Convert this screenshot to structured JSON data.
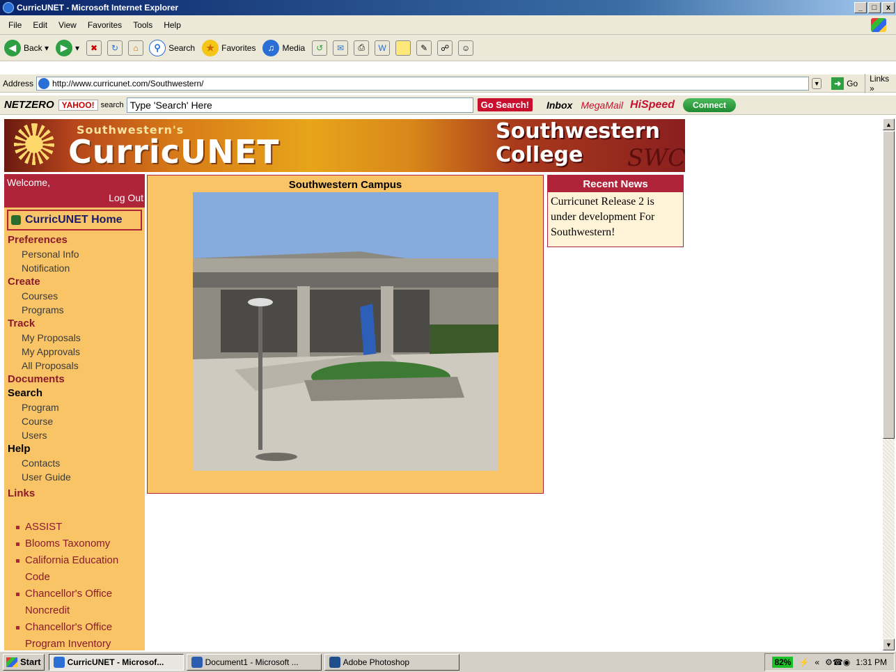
{
  "window": {
    "title": "CurricUNET - Microsoft Internet Explorer",
    "min": "_",
    "max": "□",
    "close": "x"
  },
  "menu": [
    "File",
    "Edit",
    "View",
    "Favorites",
    "Tools",
    "Help"
  ],
  "toolbar": {
    "back": "Back",
    "search": "Search",
    "favorites": "Favorites",
    "media": "Media"
  },
  "address": {
    "label": "Address",
    "url": "http://www.curricunet.com/Southwestern/",
    "go": "Go",
    "links": "Links"
  },
  "netzero": {
    "logo": "NETZERO",
    "yahoo": "YAHOO!",
    "search_word": "search",
    "search_placeholder": "Type 'Search' Here",
    "go_search": "Go Search!",
    "inbox": "Inbox",
    "megamail": "MegaMail",
    "hispeed": "HiSpeed",
    "connect": "Connect"
  },
  "banner": {
    "subtitle": "Southwestern's",
    "title": "CurricUNET",
    "college1": "Southwestern",
    "college2": "College",
    "swc": "SWC"
  },
  "sidebar": {
    "welcome": "Welcome,",
    "logout": "Log Out",
    "home": "CurricUNET Home",
    "sections": [
      {
        "title": "Preferences",
        "items": [
          "Personal Info",
          "Notification"
        ]
      },
      {
        "title": "Create",
        "items": [
          "Courses",
          "Programs"
        ]
      },
      {
        "title": "Track",
        "items": [
          "My Proposals",
          "My Approvals",
          "All Proposals"
        ]
      },
      {
        "title": "Documents",
        "items": []
      },
      {
        "title": "Search",
        "items": [
          "Program",
          "Course",
          "Users"
        ]
      },
      {
        "title": "Help",
        "items": [
          "Contacts",
          "User Guide"
        ]
      },
      {
        "title": "Links",
        "items": []
      }
    ],
    "links": [
      "ASSIST",
      "Blooms Taxonomy",
      "California Education Code",
      "Chancellor's Office Noncredit",
      "Chancellor's Office Program Inventory"
    ]
  },
  "campus": {
    "title": "Southwestern Campus"
  },
  "news": {
    "title": "Recent News",
    "body": "Curricunet Release 2 is under development For Southwestern!"
  },
  "taskbar": {
    "start": "Start",
    "tasks": [
      "CurricUNET - Microsof...",
      "Document1 - Microsoft ...",
      "Adobe Photoshop"
    ],
    "battery": "82%",
    "clock": "1:31 PM"
  },
  "colors": {
    "accent": "#b0243a",
    "sidebar_bg": "#f9c466"
  }
}
